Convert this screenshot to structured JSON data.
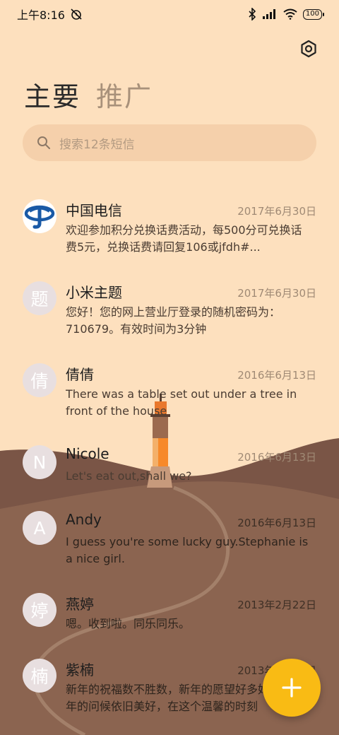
{
  "status_bar": {
    "time": "上午8:16",
    "battery": "100",
    "icons": [
      "alarm-off-icon",
      "bluetooth-icon",
      "signal-icon",
      "wifi-icon",
      "battery-icon"
    ]
  },
  "header": {
    "settings_icon": "gear-icon",
    "tabs": [
      {
        "label": "主要",
        "active": true
      },
      {
        "label": "推广",
        "active": false
      }
    ]
  },
  "search": {
    "placeholder": "搜索12条短信",
    "icon": "search-icon"
  },
  "threads": [
    {
      "avatar": "",
      "avatar_type": "china-telecom-logo",
      "name": "中国电信",
      "date": "2017年6月30日",
      "preview": "欢迎参加积分兑换话费活动，每500分可兑换话费5元，兑换话费请回复106或jfdh#..."
    },
    {
      "avatar": "题",
      "name": "小米主题",
      "date": "2017年6月30日",
      "preview": "您好！您的网上营业厅登录的随机密码为：710679。有效时间为3分钟"
    },
    {
      "avatar": "倩",
      "name": "倩倩",
      "date": "2016年6月13日",
      "preview": "There was a table set out under a tree in front of the house"
    },
    {
      "avatar": "N",
      "name": "Nicole",
      "date": "2016年6月13日",
      "preview": "Let's eat out,shall we?"
    },
    {
      "avatar": "A",
      "name": "Andy",
      "date": "2016年6月13日",
      "preview": "I guess you're some lucky guy.Stephanie is a nice girl."
    },
    {
      "avatar": "婷",
      "name": "燕婷",
      "date": "2013年2月22日",
      "preview": "嗯。收到啦。同乐同乐。"
    },
    {
      "avatar": "楠",
      "name": "紫楠",
      "date": "2013年2月22日",
      "preview": "新年的祝福数不胜数，新年的愿望好多好多，新年的问候依旧美好，在这个温馨的时刻"
    }
  ],
  "fab": {
    "icon": "plus-icon"
  },
  "colors": {
    "background": "#fde0be",
    "hill_far": "#7a5545",
    "hill_near": "#8a634f",
    "accent": "#f9bb14"
  }
}
